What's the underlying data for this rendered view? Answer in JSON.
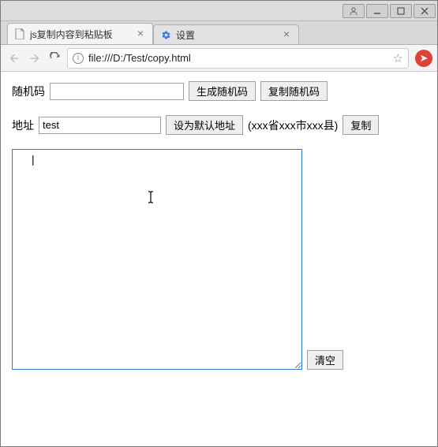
{
  "window": {
    "tabs": [
      {
        "title": "js复制内容到粘贴板",
        "icon": "file"
      },
      {
        "title": "设置",
        "icon": "gear"
      }
    ]
  },
  "url": "file:///D:/Test/copy.html",
  "extension_glyph": "➤",
  "page": {
    "random_label": "随机码",
    "random_value": "",
    "generate_btn": "生成随机码",
    "copy_random_btn": "复制随机码",
    "address_label": "地址",
    "address_value": "test",
    "set_default_btn": "设为默认地址",
    "address_hint": "(xxx省xxx市xxx县)",
    "copy_btn": "复制",
    "textarea_value": "|",
    "clear_btn": "清空"
  }
}
